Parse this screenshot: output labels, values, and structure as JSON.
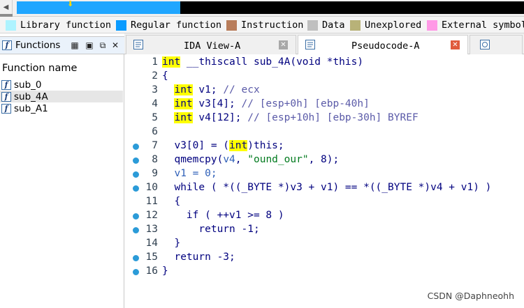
{
  "legend": [
    {
      "label": "Library function",
      "color": "#aef3ff"
    },
    {
      "label": "Regular function",
      "color": "#0a9bff"
    },
    {
      "label": "Instruction",
      "color": "#b87c5a"
    },
    {
      "label": "Data",
      "color": "#bfbfbf"
    },
    {
      "label": "Unexplored",
      "color": "#b8b278"
    },
    {
      "label": "External symbol",
      "color": "#ff99e6"
    }
  ],
  "functions_panel": {
    "title": "Functions",
    "column_header": "Function name",
    "items": [
      "sub_0",
      "sub_4A",
      "sub_A1"
    ],
    "selected": "sub_4A"
  },
  "tabs": [
    {
      "label": "IDA View-A",
      "active": false
    },
    {
      "label": "Pseudocode-A",
      "active": true
    }
  ],
  "code": {
    "line_numbers": [
      "1",
      "2",
      "3",
      "4",
      "5",
      "6",
      "7",
      "8",
      "9",
      "10",
      "11",
      "12",
      "13",
      "14",
      "15",
      "16"
    ],
    "l1": {
      "kw": "int",
      "rest": " __thiscall sub_4A(void *this)"
    },
    "l2": "{",
    "l3": {
      "kw": "int",
      "rest": " v1; ",
      "comment": "// ecx"
    },
    "l4": {
      "kw": "int",
      "rest": " v3[4]; ",
      "comment": "// [esp+0h] [ebp-40h]"
    },
    "l5": {
      "kw": "int",
      "rest": " v4[12]; ",
      "comment": "// [esp+10h] [ebp-30h] BYREF"
    },
    "l7": {
      "pre": "v3[0] = (",
      "kw": "int",
      "post": ")this;"
    },
    "l8": {
      "pre": "qmemcpy(",
      "var": "v4",
      "mid": ", ",
      "str": "\"ound_our\"",
      "post": ", 8);"
    },
    "l9": "v1 = 0;",
    "l10": "while ( *((_BYTE *)v3 + v1) == *((_BYTE *)v4 + v1) )",
    "l11": "{",
    "l12": "if ( ++v1 >= 8 )",
    "l13": "return -1;",
    "l14": "}",
    "l15": "return -3;",
    "l16": "}"
  },
  "watermark": "CSDN @Daphneohh"
}
